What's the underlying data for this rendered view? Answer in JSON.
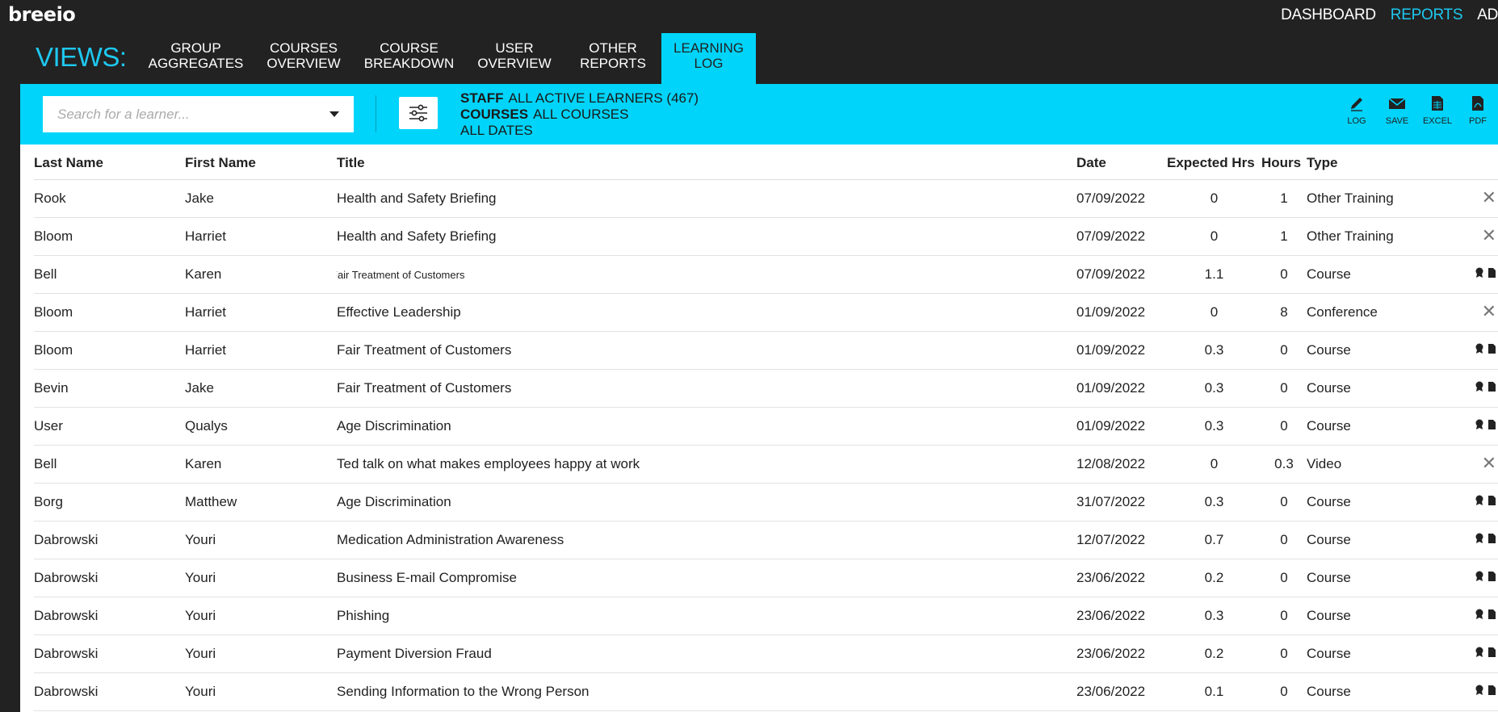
{
  "app": {
    "logo": "breeio"
  },
  "topnav": [
    {
      "label": "DASHBOARD",
      "active": false
    },
    {
      "label": "REPORTS",
      "active": true
    },
    {
      "label": "AD",
      "active": false
    }
  ],
  "views": {
    "label": "VIEWS:",
    "tabs": [
      {
        "line1": "GROUP",
        "line2": "AGGREGATES",
        "active": false
      },
      {
        "line1": "COURSES",
        "line2": "OVERVIEW",
        "active": false
      },
      {
        "line1": "COURSE",
        "line2": "BREAKDOWN",
        "active": false
      },
      {
        "line1": "USER",
        "line2": "OVERVIEW",
        "active": false
      },
      {
        "line1": "OTHER",
        "line2": "REPORTS",
        "active": false
      },
      {
        "line1": "LEARNING",
        "line2": "LOG",
        "active": true
      }
    ]
  },
  "search": {
    "placeholder": "Search for a learner..."
  },
  "filters": {
    "staff_key": "STAFF",
    "staff_value": "ALL ACTIVE LEARNERS (467)",
    "courses_key": "COURSES",
    "courses_value": "ALL COURSES",
    "dates": "ALL DATES"
  },
  "actions": [
    {
      "label": "LOG",
      "icon": "pencil-icon"
    },
    {
      "label": "SAVE",
      "icon": "envelope-icon"
    },
    {
      "label": "EXCEL",
      "icon": "spreadsheet-icon"
    },
    {
      "label": "PDF",
      "icon": "pdf-icon"
    }
  ],
  "table": {
    "columns": [
      "Last Name",
      "First Name",
      "Title",
      "Date",
      "Expected Hrs",
      "Hours",
      "Type"
    ],
    "rows": [
      {
        "last": "Rook",
        "first": "Jake",
        "title": "Health and Safety Briefing",
        "date": "07/09/2022",
        "expected": "0",
        "hours": "1",
        "type": "Other Training",
        "action": "delete"
      },
      {
        "last": "Bloom",
        "first": "Harriet",
        "title": "Health and Safety Briefing",
        "date": "07/09/2022",
        "expected": "0",
        "hours": "1",
        "type": "Other Training",
        "action": "delete"
      },
      {
        "last": "Bell",
        "first": "Karen",
        "title": "Fair Treatment of Customers",
        "date": "07/09/2022",
        "expected": "1.1",
        "hours": "0",
        "type": "Course",
        "action": "certificate",
        "small": true
      },
      {
        "last": "Bloom",
        "first": "Harriet",
        "title": "Effective Leadership",
        "date": "01/09/2022",
        "expected": "0",
        "hours": "8",
        "type": "Conference",
        "action": "delete"
      },
      {
        "last": "Bloom",
        "first": "Harriet",
        "title": "Fair Treatment of Customers",
        "date": "01/09/2022",
        "expected": "0.3",
        "hours": "0",
        "type": "Course",
        "action": "certificate"
      },
      {
        "last": "Bevin",
        "first": "Jake",
        "title": "Fair Treatment of Customers",
        "date": "01/09/2022",
        "expected": "0.3",
        "hours": "0",
        "type": "Course",
        "action": "certificate"
      },
      {
        "last": "User",
        "first": "Qualys",
        "title": "Age Discrimination",
        "date": "01/09/2022",
        "expected": "0.3",
        "hours": "0",
        "type": "Course",
        "action": "certificate"
      },
      {
        "last": "Bell",
        "first": "Karen",
        "title": "Ted talk on what makes employees happy at work",
        "date": "12/08/2022",
        "expected": "0",
        "hours": "0.3",
        "type": "Video",
        "action": "delete"
      },
      {
        "last": "Borg",
        "first": "Matthew",
        "title": "Age Discrimination",
        "date": "31/07/2022",
        "expected": "0.3",
        "hours": "0",
        "type": "Course",
        "action": "certificate"
      },
      {
        "last": "Dabrowski",
        "first": "Youri",
        "title": "Medication Administration Awareness",
        "date": "12/07/2022",
        "expected": "0.7",
        "hours": "0",
        "type": "Course",
        "action": "certificate"
      },
      {
        "last": "Dabrowski",
        "first": "Youri",
        "title": "Business E-mail Compromise",
        "date": "23/06/2022",
        "expected": "0.2",
        "hours": "0",
        "type": "Course",
        "action": "certificate"
      },
      {
        "last": "Dabrowski",
        "first": "Youri",
        "title": "Phishing",
        "date": "23/06/2022",
        "expected": "0.3",
        "hours": "0",
        "type": "Course",
        "action": "certificate"
      },
      {
        "last": "Dabrowski",
        "first": "Youri",
        "title": "Payment Diversion Fraud",
        "date": "23/06/2022",
        "expected": "0.2",
        "hours": "0",
        "type": "Course",
        "action": "certificate"
      },
      {
        "last": "Dabrowski",
        "first": "Youri",
        "title": "Sending Information to the Wrong Person",
        "date": "23/06/2022",
        "expected": "0.1",
        "hours": "0",
        "type": "Course",
        "action": "certificate"
      }
    ]
  },
  "colors": {
    "accent": "#00d4fa",
    "background": "#222222",
    "active_nav": "#1ec8f0"
  }
}
